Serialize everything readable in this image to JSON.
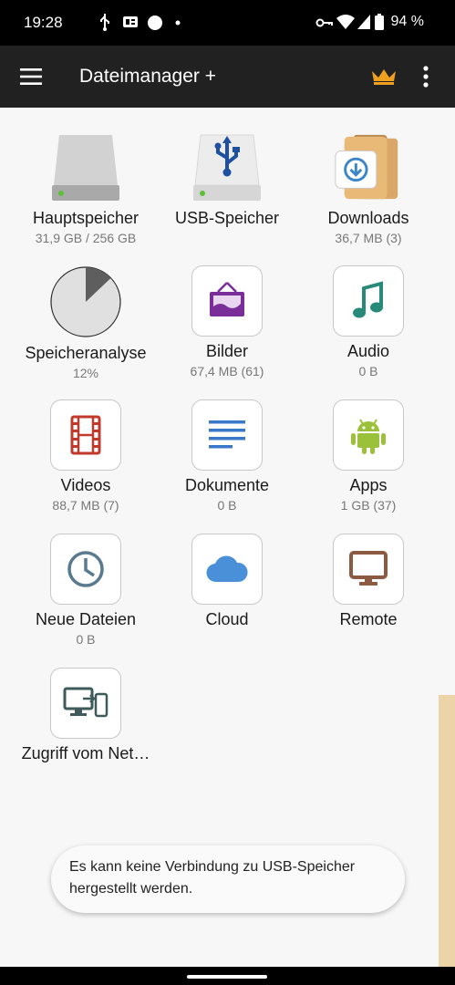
{
  "status": {
    "time": "19:28",
    "battery": "94 %"
  },
  "appbar": {
    "title": "Dateimanager +"
  },
  "tiles": [
    {
      "label": "Hauptspeicher",
      "sub": "31,9 GB / 256 GB"
    },
    {
      "label": "USB-Speicher",
      "sub": ""
    },
    {
      "label": "Downloads",
      "sub": "36,7 MB (3)"
    },
    {
      "label": "Speicheranalyse",
      "sub": "12%"
    },
    {
      "label": "Bilder",
      "sub": "67,4 MB (61)"
    },
    {
      "label": "Audio",
      "sub": "0 B"
    },
    {
      "label": "Videos",
      "sub": "88,7 MB (7)"
    },
    {
      "label": "Dokumente",
      "sub": "0 B"
    },
    {
      "label": "Apps",
      "sub": "1 GB (37)"
    },
    {
      "label": "Neue Dateien",
      "sub": "0 B"
    },
    {
      "label": "Cloud",
      "sub": ""
    },
    {
      "label": "Remote",
      "sub": ""
    },
    {
      "label": "Zugriff vom Net…",
      "sub": ""
    }
  ],
  "toast": {
    "message": "Es kann keine Verbindung zu USB-Speicher hergestellt werden."
  },
  "colors": {
    "crown": "#f0a020",
    "appbar": "#212121",
    "usb": "#1e4fa0",
    "pictures": "#7a2e9a",
    "music": "#2a8a7a",
    "video": "#c0392b",
    "docs": "#3a78c9",
    "android": "#9bc13a",
    "clock": "#5a7a90",
    "cloud": "#4a90d9",
    "remote": "#8b5a40",
    "network": "#3f5a5a"
  }
}
